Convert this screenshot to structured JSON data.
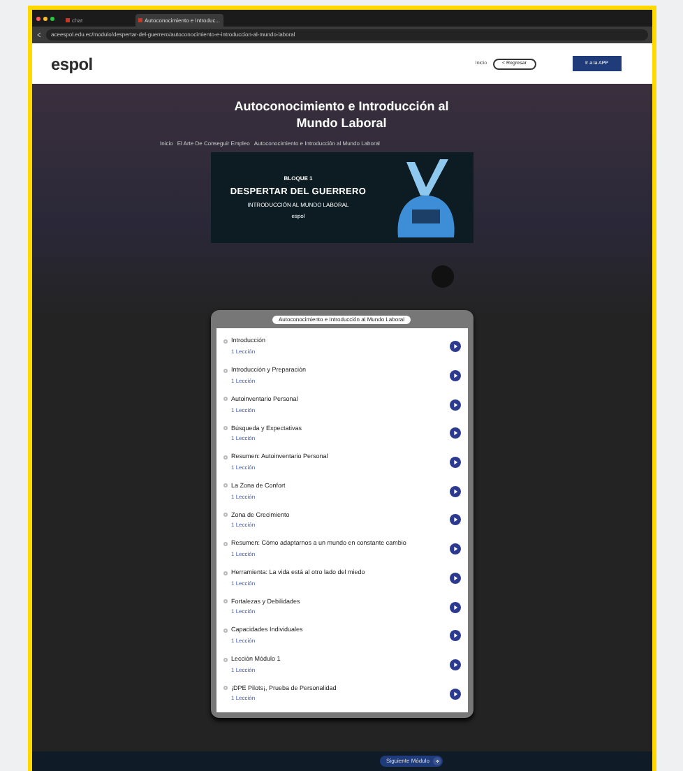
{
  "browser": {
    "tabs": [
      {
        "label": "chat",
        "selected": false
      },
      {
        "label": "Autoconocimiento e Introduc...",
        "selected": true
      }
    ],
    "url": "aceespol.edu.ec/modulo/despertar-del-guerrero/autoconocimiento-e-introduccion-al-mundo-laboral"
  },
  "header": {
    "logo": "espol",
    "nav_link": "Inicio",
    "back_button": "< Regresar",
    "app_button": "Ir a la APP"
  },
  "hero": {
    "title": "Autoconocimiento e Introducción al Mundo Laboral",
    "breadcrumb": [
      "Inicio",
      "El Arte De Conseguir Empleo",
      "Autoconocimiento e Introducción al Mundo Laboral"
    ],
    "banner": {
      "kicker": "BLOQUE 1",
      "title": "DESPERTAR DEL GUERRERO",
      "subtitle": "INTRODUCCIÓN AL MUNDO LABORAL",
      "brand": "espol"
    }
  },
  "lessons": {
    "title": "Autoconocimiento e Introducción al Mundo Laboral",
    "items": [
      {
        "title": "Introducción",
        "meta": "1 Lección"
      },
      {
        "title": "Introducción y Preparación",
        "meta": "1 Lección"
      },
      {
        "title": "Autoinventario Personal",
        "meta": "1 Lección"
      },
      {
        "title": "Búsqueda y Expectativas",
        "meta": "1 Lección"
      },
      {
        "title": "Resumen: Autoinventario Personal",
        "meta": "1 Lección"
      },
      {
        "title": "La Zona de Confort",
        "meta": "1 Lección"
      },
      {
        "title": "Zona de Crecimiento",
        "meta": "1 Lección"
      },
      {
        "title": "Resumen: Cómo adaptarnos a un mundo en constante cambio",
        "meta": "1 Lección"
      },
      {
        "title": "Herramienta: La vida está al otro lado del miedo",
        "meta": "1 Lección"
      },
      {
        "title": "Fortalezas y Debilidades",
        "meta": "1 Lección"
      },
      {
        "title": "Capacidades Individuales",
        "meta": "1 Lección"
      },
      {
        "title": "Lección Módulo 1",
        "meta": "1 Lección"
      },
      {
        "title": "¡DPE Pilots¡, Prueba de Personalidad",
        "meta": "1 Lección"
      }
    ]
  },
  "footer": {
    "next_button": "Siguiente Módulo"
  }
}
